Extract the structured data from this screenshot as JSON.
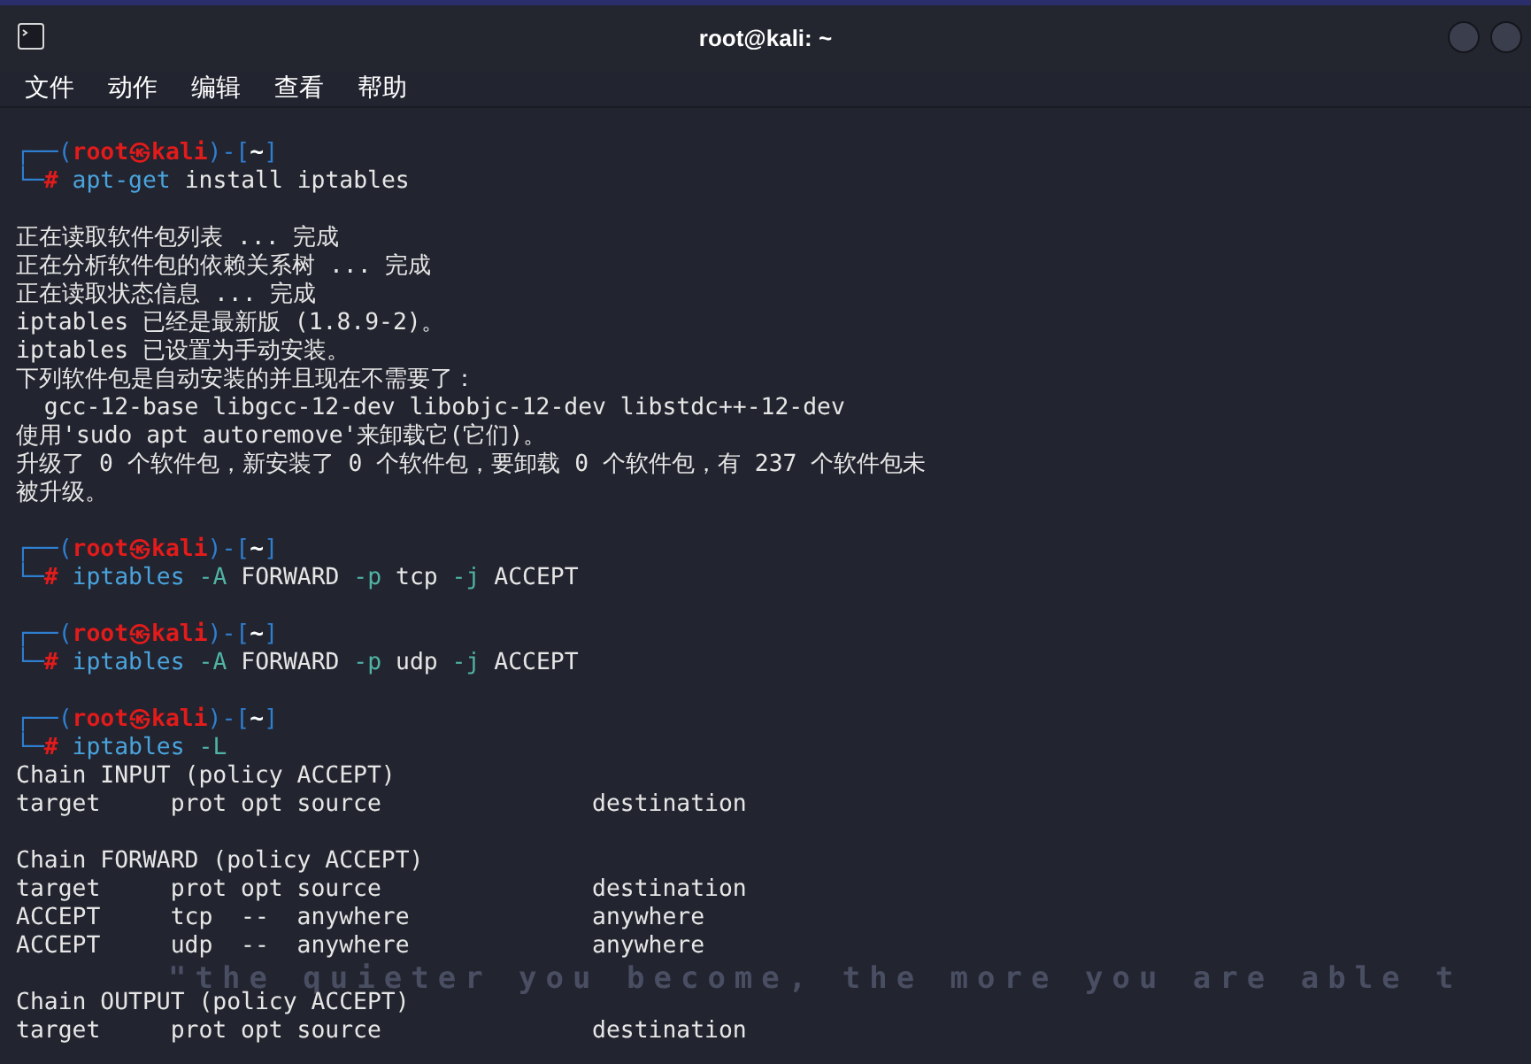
{
  "window": {
    "title": "root@kali: ~"
  },
  "menu": [
    "文件",
    "动作",
    "编辑",
    "查看",
    "帮助"
  ],
  "wallpaper": {
    "tagline": "\"the quieter you become, the more you are able t"
  },
  "lines": [
    {
      "kind": "prompt",
      "top": [
        {
          "kind": "frame",
          "text": "┌──("
        },
        {
          "kind": "host",
          "text": "root㉿kali"
        },
        {
          "kind": "frame",
          "text": ")-["
        },
        {
          "kind": "dir",
          "text": "~"
        },
        {
          "kind": "frame",
          "text": "]"
        }
      ],
      "bottom": [
        {
          "kind": "frame",
          "text": "└─"
        },
        {
          "kind": "hash",
          "text": "#"
        },
        {
          "kind": "cmd",
          "text": "apt-get"
        },
        {
          "kind": "arg",
          "text": "install"
        },
        {
          "kind": "arg",
          "text": "iptables"
        }
      ]
    },
    {
      "kind": "blank"
    },
    {
      "kind": "output",
      "text": "正在读取软件包列表 ... 完成"
    },
    {
      "kind": "output",
      "text": "正在分析软件包的依赖关系树 ... 完成"
    },
    {
      "kind": "output",
      "text": "正在读取状态信息 ... 完成"
    },
    {
      "kind": "output",
      "text": "iptables 已经是最新版 (1.8.9-2)。"
    },
    {
      "kind": "output",
      "text": "iptables 已设置为手动安装。"
    },
    {
      "kind": "output",
      "text": "下列软件包是自动安装的并且现在不需要了："
    },
    {
      "kind": "output",
      "text": "  gcc-12-base libgcc-12-dev libobjc-12-dev libstdc++-12-dev"
    },
    {
      "kind": "output",
      "text": "使用'sudo apt autoremove'来卸载它(它们)。"
    },
    {
      "kind": "output",
      "text": "升级了 0 个软件包，新安装了 0 个软件包，要卸载 0 个软件包，有 237 个软件包未"
    },
    {
      "kind": "output",
      "text": "被升级。"
    },
    {
      "kind": "blank"
    },
    {
      "kind": "prompt",
      "top": [
        {
          "kind": "frame",
          "text": "┌──("
        },
        {
          "kind": "host",
          "text": "root㉿kali"
        },
        {
          "kind": "frame",
          "text": ")-["
        },
        {
          "kind": "dir",
          "text": "~"
        },
        {
          "kind": "frame",
          "text": "]"
        }
      ],
      "bottom": [
        {
          "kind": "frame",
          "text": "└─"
        },
        {
          "kind": "hash",
          "text": "#"
        },
        {
          "kind": "cmd",
          "text": "iptables"
        },
        {
          "kind": "flag",
          "text": "-A"
        },
        {
          "kind": "arg",
          "text": "FORWARD"
        },
        {
          "kind": "flag",
          "text": "-p"
        },
        {
          "kind": "arg",
          "text": "tcp"
        },
        {
          "kind": "flag",
          "text": "-j"
        },
        {
          "kind": "arg",
          "text": "ACCEPT"
        }
      ]
    },
    {
      "kind": "blank"
    },
    {
      "kind": "prompt",
      "top": [
        {
          "kind": "frame",
          "text": "┌──("
        },
        {
          "kind": "host",
          "text": "root㉿kali"
        },
        {
          "kind": "frame",
          "text": ")-["
        },
        {
          "kind": "dir",
          "text": "~"
        },
        {
          "kind": "frame",
          "text": "]"
        }
      ],
      "bottom": [
        {
          "kind": "frame",
          "text": "└─"
        },
        {
          "kind": "hash",
          "text": "#"
        },
        {
          "kind": "cmd",
          "text": "iptables"
        },
        {
          "kind": "flag",
          "text": "-A"
        },
        {
          "kind": "arg",
          "text": "FORWARD"
        },
        {
          "kind": "flag",
          "text": "-p"
        },
        {
          "kind": "arg",
          "text": "udp"
        },
        {
          "kind": "flag",
          "text": "-j"
        },
        {
          "kind": "arg",
          "text": "ACCEPT"
        }
      ]
    },
    {
      "kind": "blank"
    },
    {
      "kind": "prompt",
      "top": [
        {
          "kind": "frame",
          "text": "┌──("
        },
        {
          "kind": "host",
          "text": "root㉿kali"
        },
        {
          "kind": "frame",
          "text": ")-["
        },
        {
          "kind": "dir",
          "text": "~"
        },
        {
          "kind": "frame",
          "text": "]"
        }
      ],
      "bottom": [
        {
          "kind": "frame",
          "text": "└─"
        },
        {
          "kind": "hash",
          "text": "#"
        },
        {
          "kind": "cmd",
          "text": "iptables"
        },
        {
          "kind": "flag",
          "text": "-L"
        }
      ]
    },
    {
      "kind": "output",
      "text": "Chain INPUT (policy ACCEPT)"
    },
    {
      "kind": "output",
      "text": "target     prot opt source               destination"
    },
    {
      "kind": "blank"
    },
    {
      "kind": "output",
      "text": "Chain FORWARD (policy ACCEPT)"
    },
    {
      "kind": "output",
      "text": "target     prot opt source               destination"
    },
    {
      "kind": "output",
      "text": "ACCEPT     tcp  --  anywhere             anywhere"
    },
    {
      "kind": "output",
      "text": "ACCEPT     udp  --  anywhere             anywhere"
    },
    {
      "kind": "blank"
    },
    {
      "kind": "output",
      "text": "Chain OUTPUT (policy ACCEPT)"
    },
    {
      "kind": "output",
      "text": "target     prot opt source               destination"
    }
  ]
}
